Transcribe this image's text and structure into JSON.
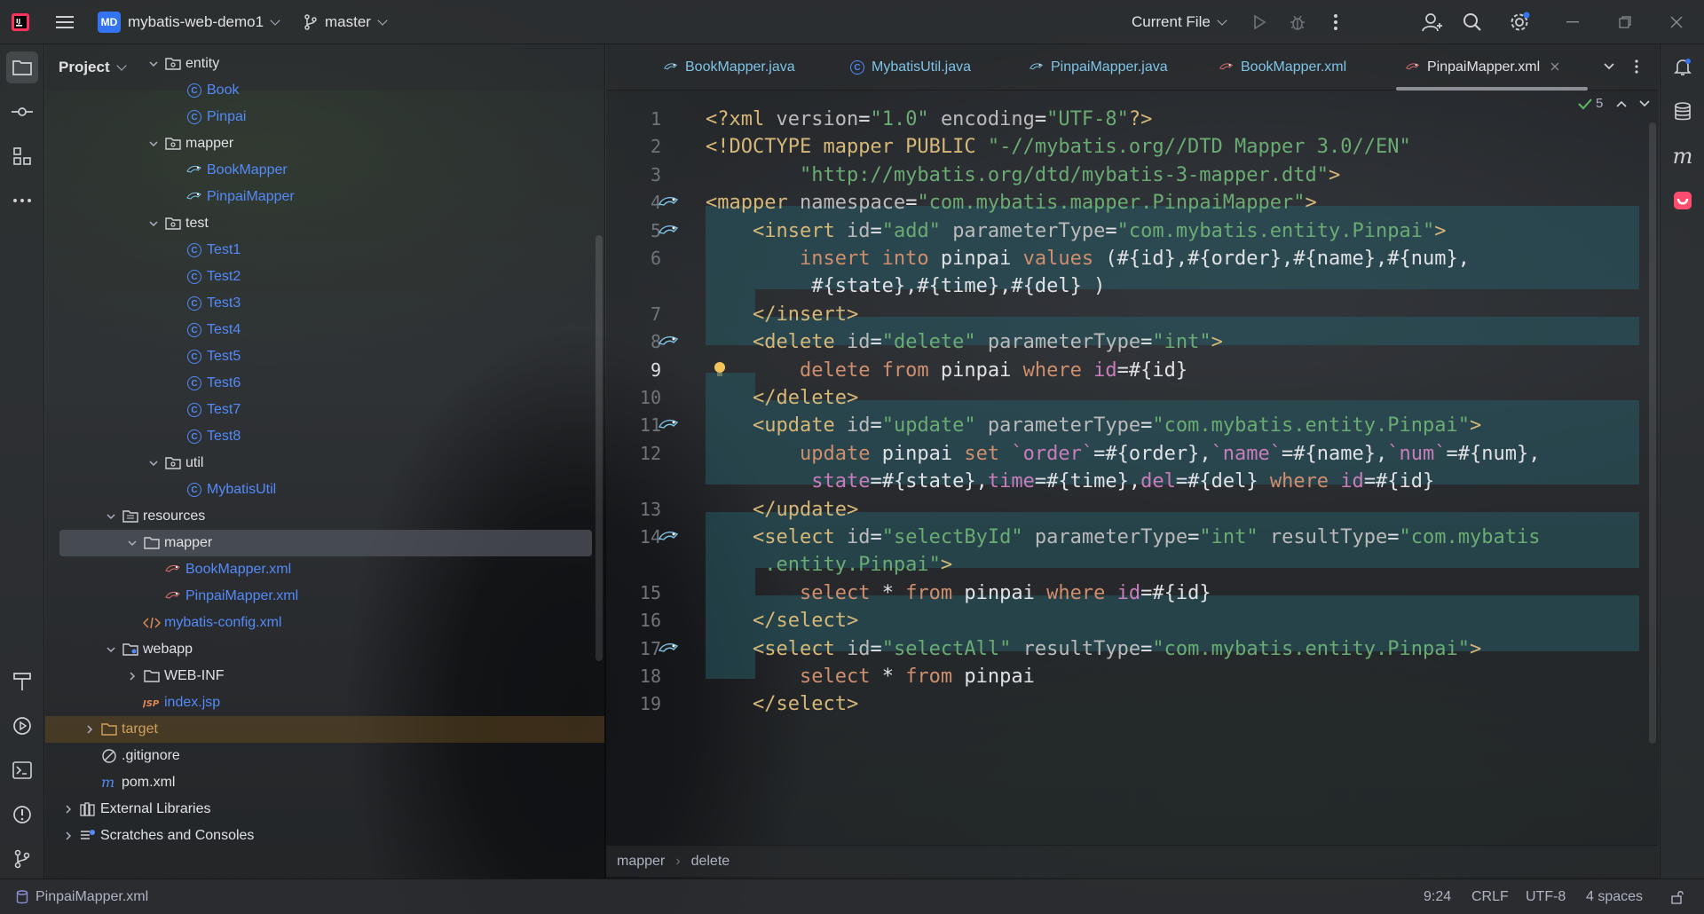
{
  "titlebar": {
    "project_badge": "MD",
    "project_name": "mybatis-web-demo1",
    "branch": "master",
    "run_config": "Current File"
  },
  "project_panel": {
    "title": "Project",
    "tree": [
      {
        "label": "entity",
        "type": "package",
        "depth": 4,
        "expanded": true
      },
      {
        "label": "Book",
        "type": "class",
        "depth": 5
      },
      {
        "label": "Pinpai",
        "type": "class",
        "depth": 5
      },
      {
        "label": "mapper",
        "type": "package",
        "depth": 4,
        "expanded": true
      },
      {
        "label": "BookMapper",
        "type": "mapper",
        "depth": 5
      },
      {
        "label": "PinpaiMapper",
        "type": "mapper",
        "depth": 5
      },
      {
        "label": "test",
        "type": "package",
        "depth": 4,
        "expanded": true
      },
      {
        "label": "Test1",
        "type": "class",
        "depth": 5
      },
      {
        "label": "Test2",
        "type": "class",
        "depth": 5
      },
      {
        "label": "Test3",
        "type": "class",
        "depth": 5
      },
      {
        "label": "Test4",
        "type": "class",
        "depth": 5
      },
      {
        "label": "Test5",
        "type": "class",
        "depth": 5
      },
      {
        "label": "Test6",
        "type": "class",
        "depth": 5
      },
      {
        "label": "Test7",
        "type": "class",
        "depth": 5
      },
      {
        "label": "Test8",
        "type": "class",
        "depth": 5
      },
      {
        "label": "util",
        "type": "package",
        "depth": 4,
        "expanded": true
      },
      {
        "label": "MybatisUtil",
        "type": "class",
        "depth": 5
      },
      {
        "label": "resources",
        "type": "resfolder",
        "depth": 2,
        "expanded": true
      },
      {
        "label": "mapper",
        "type": "folder",
        "depth": 3,
        "expanded": true,
        "selected": true
      },
      {
        "label": "BookMapper.xml",
        "type": "mapperxml",
        "depth": 4
      },
      {
        "label": "PinpaiMapper.xml",
        "type": "mapperxml",
        "depth": 4
      },
      {
        "label": "mybatis-config.xml",
        "type": "xml",
        "depth": 3
      },
      {
        "label": "webapp",
        "type": "webfolder",
        "depth": 2,
        "expanded": true
      },
      {
        "label": "WEB-INF",
        "type": "folder",
        "depth": 3,
        "expanded": false
      },
      {
        "label": "index.jsp",
        "type": "jsp",
        "depth": 3
      },
      {
        "label": "target",
        "type": "excluded",
        "depth": 1,
        "expanded": false
      },
      {
        "label": ".gitignore",
        "type": "ignore",
        "depth": 1
      },
      {
        "label": "pom.xml",
        "type": "maven",
        "depth": 1
      },
      {
        "label": "External Libraries",
        "type": "libs",
        "depth": 0,
        "expanded": false
      },
      {
        "label": "Scratches and Consoles",
        "type": "scratch",
        "depth": 0,
        "expanded": false
      }
    ]
  },
  "editor": {
    "tabs": [
      {
        "label": "BookMapper.java",
        "type": "mapper"
      },
      {
        "label": "MybatisUtil.java",
        "type": "class"
      },
      {
        "label": "PinpaiMapper.java",
        "type": "mapper"
      },
      {
        "label": "BookMapper.xml",
        "type": "mapperxml"
      },
      {
        "label": "PinpaiMapper.xml",
        "type": "mapperxml",
        "active": true
      }
    ],
    "inspection_count": "5",
    "lines": [
      {
        "n": "1",
        "segs": [
          [
            "c-tag",
            "<?xml "
          ],
          [
            "c-attr",
            "version"
          ],
          [
            "c-text",
            "="
          ],
          [
            "c-val",
            "\"1.0\""
          ],
          [
            "c-text",
            " "
          ],
          [
            "c-attr",
            "encoding"
          ],
          [
            "c-text",
            "="
          ],
          [
            "c-val",
            "\"UTF-8\""
          ],
          [
            "c-tag",
            "?>"
          ]
        ]
      },
      {
        "n": "2",
        "segs": [
          [
            "c-tag",
            "<!DOCTYPE "
          ],
          [
            "c-dt",
            "mapper PUBLIC "
          ],
          [
            "c-val",
            "\"-//mybatis.org//DTD Mapper 3.0//EN\""
          ]
        ]
      },
      {
        "n": "3",
        "segs": [
          [
            "c-text",
            "        "
          ],
          [
            "c-val",
            "\"http://mybatis.org/dtd/mybatis-3-mapper.dtd\""
          ],
          [
            "c-tag",
            ">"
          ]
        ]
      },
      {
        "n": "4",
        "segs": [
          [
            "c-tag",
            "<mapper "
          ],
          [
            "c-attr",
            "namespace"
          ],
          [
            "c-text",
            "="
          ],
          [
            "c-val",
            "\"com.mybatis.mapper.PinpaiMapper\""
          ],
          [
            "c-tag",
            ">"
          ]
        ]
      },
      {
        "n": "5",
        "segs": [
          [
            "c-text",
            "    "
          ],
          [
            "c-tag",
            "<insert "
          ],
          [
            "c-attr",
            "id"
          ],
          [
            "c-text",
            "="
          ],
          [
            "c-val",
            "\"add\""
          ],
          [
            "c-text",
            " "
          ],
          [
            "c-attr",
            "parameterType"
          ],
          [
            "c-text",
            "="
          ],
          [
            "c-val",
            "\"com.mybatis.entity.Pinpai\""
          ],
          [
            "c-tag",
            ">"
          ]
        ]
      },
      {
        "n": "6",
        "segs": [
          [
            "c-text",
            "        "
          ],
          [
            "c-kw",
            "insert into "
          ],
          [
            "c-text",
            "pinpai "
          ],
          [
            "c-kw",
            "values "
          ],
          [
            "c-text",
            "(#{id},#{order},#{name},#{num},"
          ]
        ]
      },
      {
        "n": "",
        "segs": [
          [
            "c-text",
            "         #{state},#{time},#{del} )"
          ]
        ]
      },
      {
        "n": "7",
        "segs": [
          [
            "c-text",
            "    "
          ],
          [
            "c-tag",
            "</insert>"
          ]
        ]
      },
      {
        "n": "8",
        "segs": [
          [
            "c-text",
            "    "
          ],
          [
            "c-tag",
            "<delete "
          ],
          [
            "c-attr",
            "id"
          ],
          [
            "c-text",
            "="
          ],
          [
            "c-val",
            "\"delete\""
          ],
          [
            "c-text",
            " "
          ],
          [
            "c-attr",
            "parameterType"
          ],
          [
            "c-text",
            "="
          ],
          [
            "c-val",
            "\"int\""
          ],
          [
            "c-tag",
            ">"
          ]
        ]
      },
      {
        "n": "9",
        "segs": [
          [
            "c-text",
            "        "
          ],
          [
            "c-kw",
            "delete from "
          ],
          [
            "c-text",
            "pinpai "
          ],
          [
            "c-kw",
            "where "
          ],
          [
            "c-field",
            "id"
          ],
          [
            "c-text",
            "=#{id}"
          ]
        ]
      },
      {
        "n": "10",
        "segs": [
          [
            "c-text",
            "    "
          ],
          [
            "c-tag",
            "</delete>"
          ]
        ]
      },
      {
        "n": "11",
        "segs": [
          [
            "c-text",
            "    "
          ],
          [
            "c-tag",
            "<update "
          ],
          [
            "c-attr",
            "id"
          ],
          [
            "c-text",
            "="
          ],
          [
            "c-val",
            "\"update\""
          ],
          [
            "c-text",
            " "
          ],
          [
            "c-attr",
            "parameterType"
          ],
          [
            "c-text",
            "="
          ],
          [
            "c-val",
            "\"com.mybatis.entity.Pinpai\""
          ],
          [
            "c-tag",
            ">"
          ]
        ]
      },
      {
        "n": "12",
        "segs": [
          [
            "c-text",
            "        "
          ],
          [
            "c-kw",
            "update "
          ],
          [
            "c-text",
            "pinpai "
          ],
          [
            "c-kw",
            "set "
          ],
          [
            "c-field",
            "`order`"
          ],
          [
            "c-text",
            "=#{order},"
          ],
          [
            "c-field",
            "`name`"
          ],
          [
            "c-text",
            "=#{name},"
          ],
          [
            "c-field",
            "`num`"
          ],
          [
            "c-text",
            "=#{num},"
          ]
        ]
      },
      {
        "n": "",
        "segs": [
          [
            "c-text",
            "         "
          ],
          [
            "c-field",
            "state"
          ],
          [
            "c-text",
            "=#{state},"
          ],
          [
            "c-field",
            "time"
          ],
          [
            "c-text",
            "=#{time},"
          ],
          [
            "c-field",
            "del"
          ],
          [
            "c-text",
            "=#{del} "
          ],
          [
            "c-kw",
            "where "
          ],
          [
            "c-field",
            "id"
          ],
          [
            "c-text",
            "=#{id}"
          ]
        ]
      },
      {
        "n": "13",
        "segs": [
          [
            "c-text",
            "    "
          ],
          [
            "c-tag",
            "</update>"
          ]
        ]
      },
      {
        "n": "14",
        "segs": [
          [
            "c-text",
            "    "
          ],
          [
            "c-tag",
            "<select "
          ],
          [
            "c-attr",
            "id"
          ],
          [
            "c-text",
            "="
          ],
          [
            "c-val",
            "\"selectById\""
          ],
          [
            "c-text",
            " "
          ],
          [
            "c-attr",
            "parameterType"
          ],
          [
            "c-text",
            "="
          ],
          [
            "c-val",
            "\"int\""
          ],
          [
            "c-text",
            " "
          ],
          [
            "c-attr",
            "resultType"
          ],
          [
            "c-text",
            "="
          ],
          [
            "c-val",
            "\"com.mybatis"
          ]
        ]
      },
      {
        "n": "",
        "segs": [
          [
            "c-val",
            "     .entity.Pinpai\""
          ],
          [
            "c-tag",
            ">"
          ]
        ]
      },
      {
        "n": "15",
        "segs": [
          [
            "c-text",
            "        "
          ],
          [
            "c-kw",
            "select "
          ],
          [
            "c-text",
            "* "
          ],
          [
            "c-kw",
            "from "
          ],
          [
            "c-text",
            "pinpai "
          ],
          [
            "c-kw",
            "where "
          ],
          [
            "c-field",
            "id"
          ],
          [
            "c-text",
            "=#{id}"
          ]
        ]
      },
      {
        "n": "16",
        "segs": [
          [
            "c-text",
            "    "
          ],
          [
            "c-tag",
            "</select>"
          ]
        ]
      },
      {
        "n": "17",
        "segs": [
          [
            "c-text",
            "    "
          ],
          [
            "c-tag",
            "<select "
          ],
          [
            "c-attr",
            "id"
          ],
          [
            "c-text",
            "="
          ],
          [
            "c-val",
            "\"selectAll\""
          ],
          [
            "c-text",
            " "
          ],
          [
            "c-attr",
            "resultType"
          ],
          [
            "c-text",
            "="
          ],
          [
            "c-val",
            "\"com.mybatis.entity.Pinpai\""
          ],
          [
            "c-tag",
            ">"
          ]
        ]
      },
      {
        "n": "18",
        "segs": [
          [
            "c-text",
            "        "
          ],
          [
            "c-kw",
            "select "
          ],
          [
            "c-text",
            "* "
          ],
          [
            "c-kw",
            "from "
          ],
          [
            "c-text",
            "pinpai"
          ]
        ]
      },
      {
        "n": "19",
        "segs": [
          [
            "c-text",
            "    "
          ],
          [
            "c-tag",
            "</select>"
          ]
        ]
      }
    ],
    "breadcrumbs": [
      "mapper",
      "delete"
    ]
  },
  "statusbar": {
    "file": "PinpaiMapper.xml",
    "position": "9:24",
    "line_ending": "CRLF",
    "encoding": "UTF-8",
    "indent": "4 spaces"
  },
  "colors": {
    "accent": "#3574f0",
    "class_icon": "#548af7",
    "tag": "#d5b778",
    "string": "#6aab73",
    "keyword": "#cf8e6d",
    "field": "#c77dbb"
  }
}
